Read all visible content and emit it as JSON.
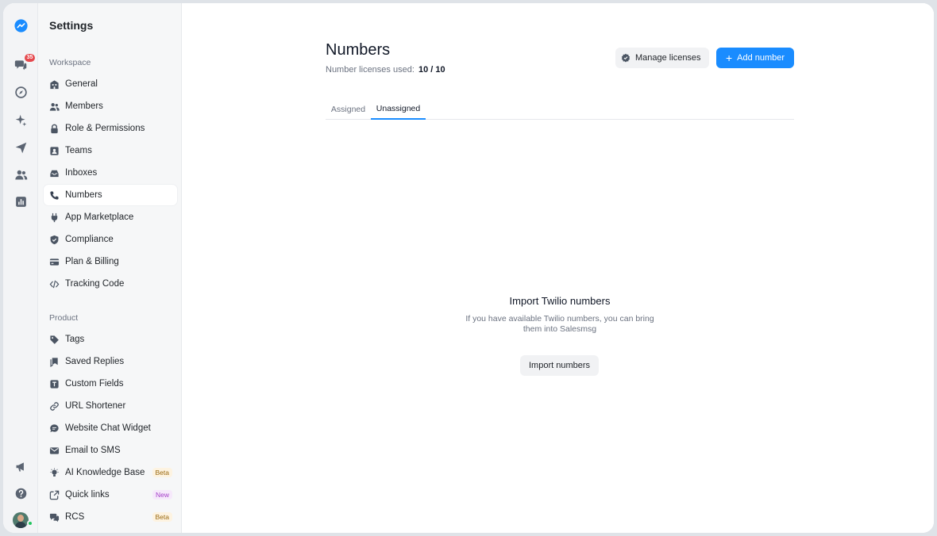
{
  "rail": {
    "badge_count": "35"
  },
  "sidebar": {
    "title": "Settings",
    "workspace_label": "Workspace",
    "product_label": "Product",
    "workspace_items": [
      {
        "label": "General",
        "icon": "building-icon"
      },
      {
        "label": "Members",
        "icon": "users-icon"
      },
      {
        "label": "Role & Permissions",
        "icon": "lock-icon"
      },
      {
        "label": "Teams",
        "icon": "id-card-icon"
      },
      {
        "label": "Inboxes",
        "icon": "inbox-icon"
      },
      {
        "label": "Numbers",
        "icon": "phone-icon",
        "active": true
      },
      {
        "label": "App Marketplace",
        "icon": "plug-icon"
      },
      {
        "label": "Compliance",
        "icon": "shield-icon"
      },
      {
        "label": "Plan & Billing",
        "icon": "credit-card-icon"
      },
      {
        "label": "Tracking Code",
        "icon": "code-icon"
      }
    ],
    "product_items": [
      {
        "label": "Tags",
        "icon": "tag-icon"
      },
      {
        "label": "Saved Replies",
        "icon": "saved-replies-icon"
      },
      {
        "label": "Custom Fields",
        "icon": "text-field-icon"
      },
      {
        "label": "URL Shortener",
        "icon": "link-icon"
      },
      {
        "label": "Website Chat Widget",
        "icon": "chat-bubble-icon"
      },
      {
        "label": "Email to SMS",
        "icon": "envelope-icon"
      },
      {
        "label": "AI Knowledge Base",
        "icon": "lightbulb-icon",
        "tag": "Beta"
      },
      {
        "label": "Quick links",
        "icon": "external-link-icon",
        "tag": "New"
      },
      {
        "label": "RCS",
        "icon": "chat-bubbles-icon",
        "tag": "Beta"
      }
    ]
  },
  "header": {
    "title": "Numbers",
    "license_label": "Number licenses used:",
    "license_value": "10 / 10",
    "manage_label": "Manage licenses",
    "add_label": "Add number"
  },
  "tabs": [
    {
      "label": "Assigned",
      "active": false
    },
    {
      "label": "Unassigned",
      "active": true
    }
  ],
  "empty_state": {
    "title": "Import Twilio numbers",
    "description": "If you have available Twilio numbers, you can bring them into Salesmsg",
    "button_label": "Import numbers"
  },
  "colors": {
    "accent": "#1a8cff",
    "badge": "#e5484d",
    "online": "#22c55e"
  }
}
